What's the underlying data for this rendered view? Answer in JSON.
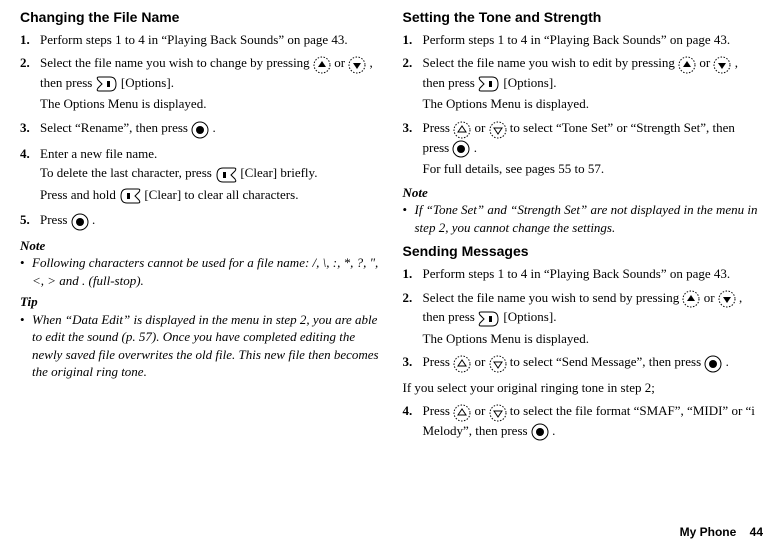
{
  "left": {
    "heading1": "Changing the File Name",
    "s1": {
      "n": "1.",
      "t": "Perform steps 1 to 4 in “Playing Back Sounds” on page 43."
    },
    "s2": {
      "n": "2.",
      "t1": "Select the file name you wish to change by pressing ",
      "t2": " or ",
      "t3": ", then press ",
      "t4": " [Options].",
      "sub": "The Options Menu is displayed."
    },
    "s3": {
      "n": "3.",
      "t1": "Select “Rename”, then press ",
      "t2": "."
    },
    "s4": {
      "n": "4.",
      "t1": "Enter a new file name.",
      "sub1a": "To delete the last character, press ",
      "sub1b": " [Clear] briefly.",
      "sub2a": "Press and hold ",
      "sub2b": " [Clear] to clear all characters."
    },
    "s5": {
      "n": "5.",
      "t1": "Press ",
      "t2": "."
    },
    "noteLabel": "Note",
    "note": "Following characters cannot be used for a file name: /, \\, :, *, ?, \", <, > and . (full-stop).",
    "tipLabel": "Tip",
    "tip": "When “Data Edit” is displayed in the menu in step 2, you are able to edit the sound (p. 57). Once you have completed editing the newly saved file overwrites the old file. This new file then becomes the original ring tone."
  },
  "right": {
    "heading1": "Setting the Tone and Strength",
    "a1": {
      "n": "1.",
      "t": "Perform steps 1 to 4 in “Playing Back Sounds” on page 43."
    },
    "a2": {
      "n": "2.",
      "t1": "Select the file name you wish to edit by pressing ",
      "t2": " or ",
      "t3": ", then press ",
      "t4": " [Options].",
      "sub": "The Options Menu is displayed."
    },
    "a3": {
      "n": "3.",
      "t1": "Press ",
      "t2": " or ",
      "t3": " to select “Tone Set” or “Strength Set”, then press ",
      "t4": ".",
      "sub": "For full details, see pages 55 to 57."
    },
    "noteLabel": "Note",
    "note": "If “Tone Set” and “Strength Set” are not displayed in the menu in step 2, you cannot change the settings.",
    "heading2": "Sending Messages",
    "b1": {
      "n": "1.",
      "t": "Perform steps 1 to 4 in “Playing Back Sounds” on page 43."
    },
    "b2": {
      "n": "2.",
      "t1": "Select the file name you wish to send by pressing ",
      "t2": " or ",
      "t3": ", then press ",
      "t4": " [Options].",
      "sub": "The Options Menu is displayed."
    },
    "b3": {
      "n": "3.",
      "t1": "Press ",
      "t2": " or ",
      "t3": " to select “Send Message”, then press ",
      "t4": "."
    },
    "ifline": "If you select your original ringing tone in step 2;",
    "b4": {
      "n": "4.",
      "t1": "Press ",
      "t2": " or ",
      "t3": " to select the file format “SMAF”, “MIDI” or “i Melody”, then press ",
      "t4": "."
    }
  },
  "footer": {
    "label": "My Phone",
    "page": "44"
  }
}
